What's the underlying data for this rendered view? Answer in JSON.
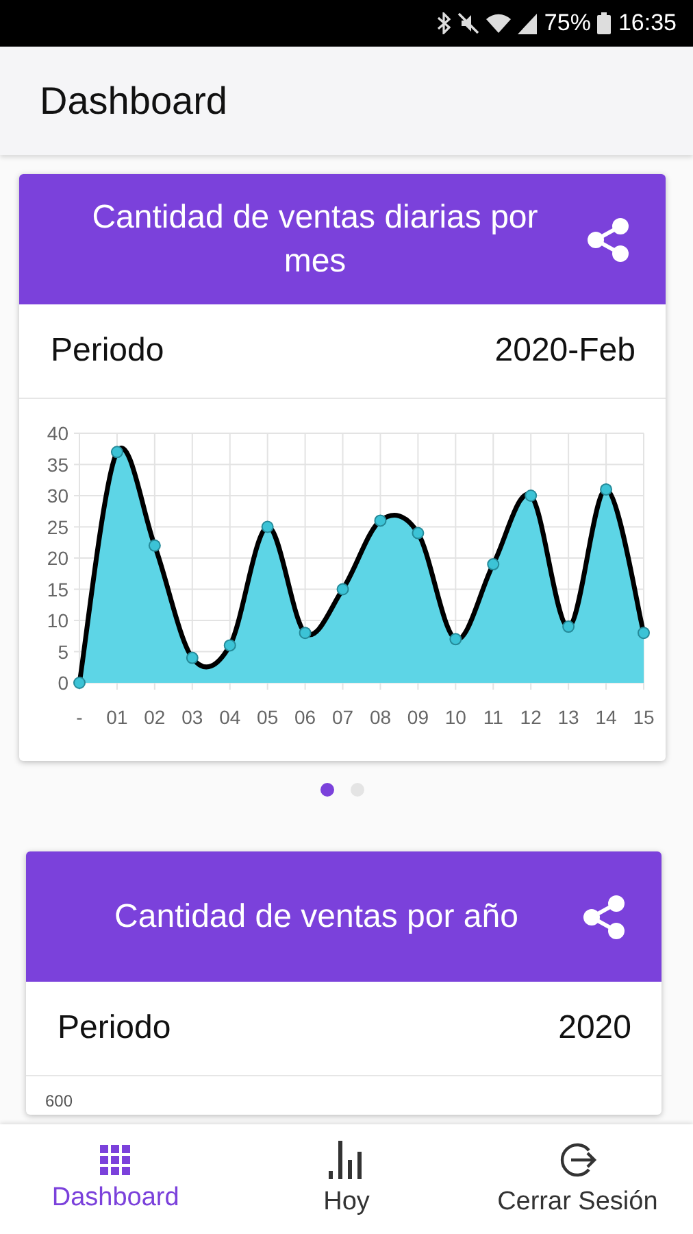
{
  "status_bar": {
    "battery": "75%",
    "time": "16:35"
  },
  "app_bar": {
    "title": "Dashboard"
  },
  "cards": [
    {
      "title": "Cantidad de ventas diarias por mes",
      "period_label": "Periodo",
      "period_value": "2020-Feb",
      "chart_data": {
        "type": "area",
        "categories": [
          "-",
          "01",
          "02",
          "03",
          "04",
          "05",
          "06",
          "07",
          "08",
          "09",
          "10",
          "11",
          "12",
          "13",
          "14",
          "15"
        ],
        "grid": true,
        "series": [
          {
            "color": "#5dd5e6",
            "values": [
              0,
              37,
              22,
              4,
              6,
              25,
              8,
              15,
              26,
              24,
              7,
              19,
              30,
              9,
              31,
              8
            ]
          }
        ],
        "ylim": [
          0,
          40
        ],
        "yticks": [
          0,
          5,
          10,
          15,
          20,
          25,
          30,
          35,
          40
        ]
      },
      "pager": [
        {
          "selected": true
        },
        {
          "selected": false
        }
      ]
    },
    {
      "title": "Cantidad de ventas por año",
      "period_label": "Periodo",
      "period_value": "2020",
      "chart_top_label": "600"
    }
  ],
  "nav": {
    "items": [
      {
        "label": "Dashboard",
        "selected": true
      },
      {
        "label": "Hoy",
        "selected": false
      },
      {
        "label": "Cerrar Sesión",
        "selected": false
      }
    ]
  }
}
